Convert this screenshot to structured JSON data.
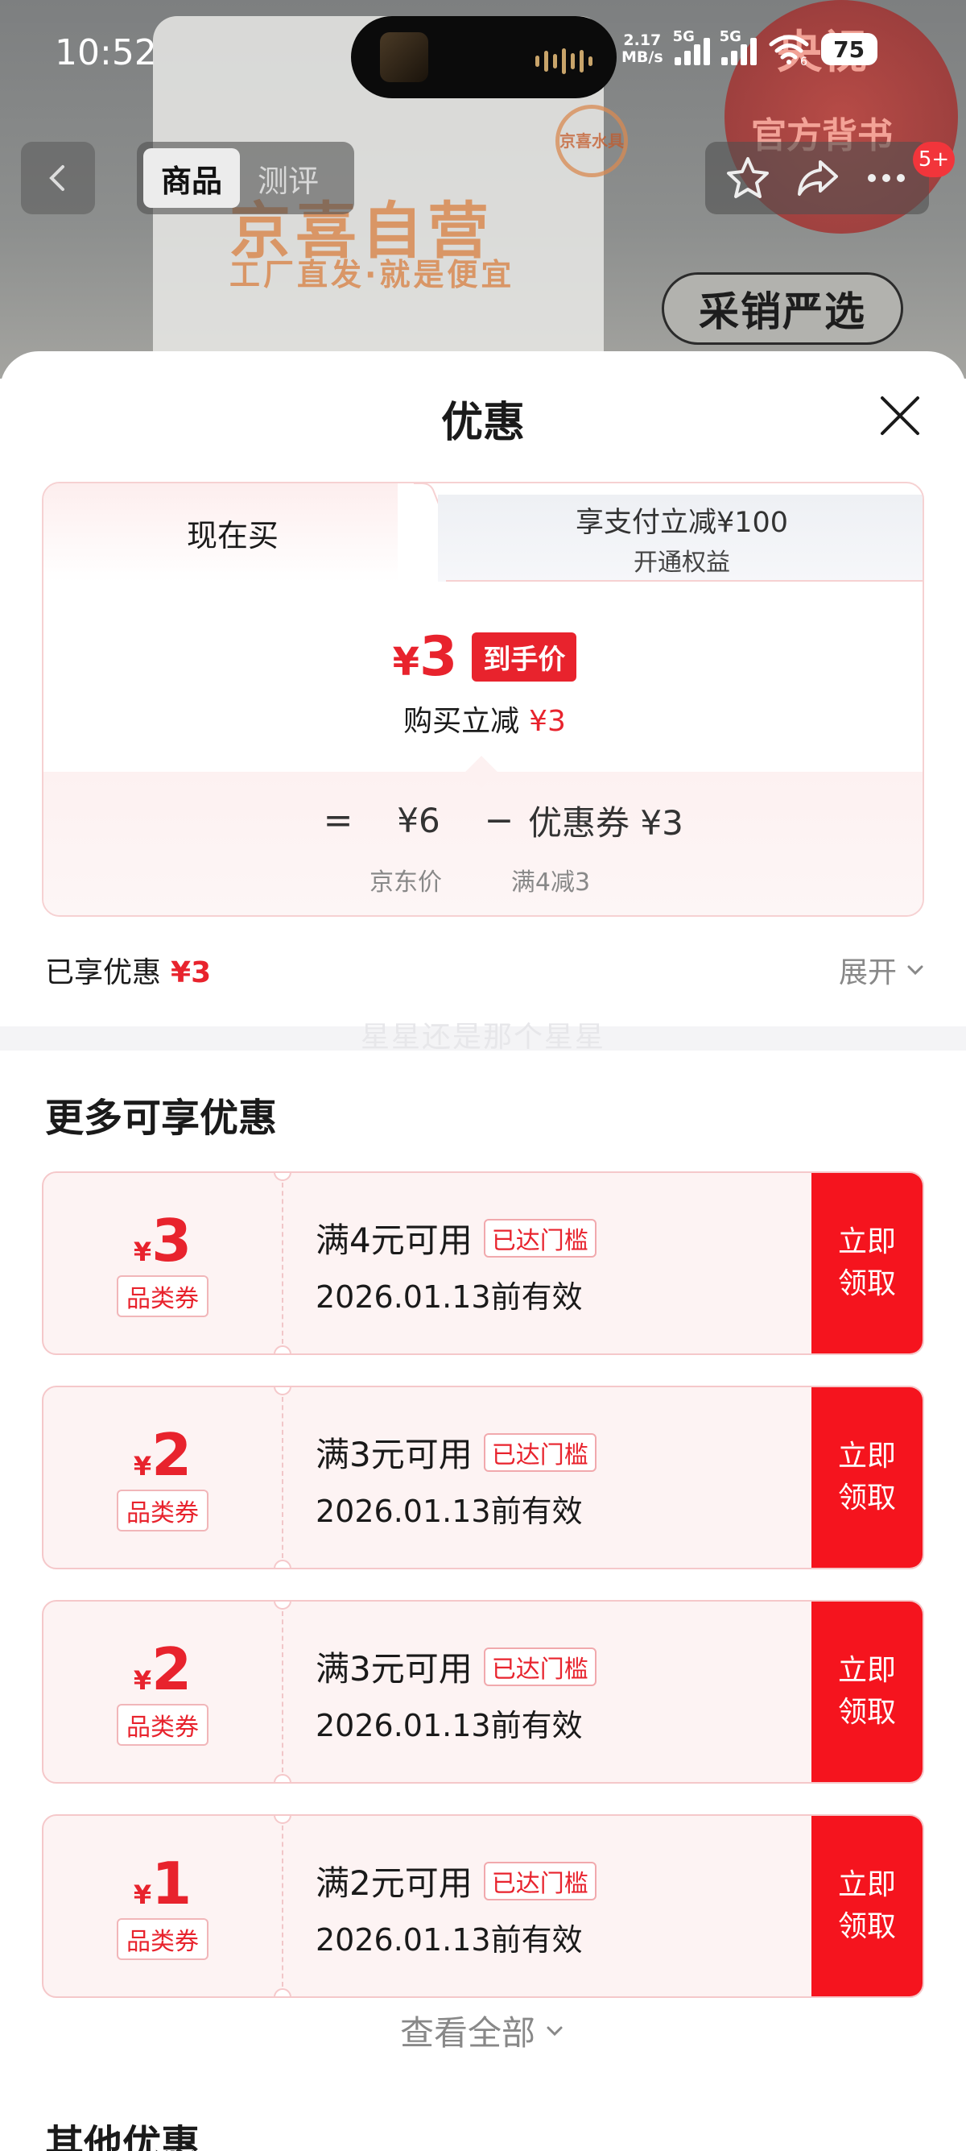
{
  "status_bar": {
    "time": "10:52",
    "speed_line1": "2.17",
    "speed_line2": "MB/s",
    "network1": "5G",
    "network2": "5G",
    "wifi_sub": "6",
    "battery": "75"
  },
  "background": {
    "bag_brand": "京喜自营",
    "bag_slogan": "工厂直发·就是便宜",
    "bag_logo": "京喜水具",
    "seal_line1": "央视",
    "seal_line2": "官方背书",
    "tag": "采销严选"
  },
  "nav": {
    "tabs": [
      {
        "label": "商品",
        "active": true
      },
      {
        "label": "测评",
        "active": false
      }
    ],
    "actions": [
      "star-icon",
      "share-icon",
      "more-icon"
    ],
    "badge": "5+"
  },
  "sheet": {
    "title": "优惠",
    "close_icon": "close-icon",
    "tabs": {
      "now": "现在买",
      "pay_title": "享支付立减¥100",
      "pay_sub": "开通权益"
    },
    "final_price": {
      "currency": "¥",
      "value": "3",
      "tag": "到手价"
    },
    "reduce": {
      "label": "购买立减",
      "value": "¥3"
    },
    "formula": {
      "equals": "=",
      "jd_price": "¥6",
      "minus": "−",
      "coupon": "优惠券 ¥3",
      "jd_price_label": "京东价",
      "coupon_label": "满4减3"
    },
    "enjoyed": {
      "label": "已享优惠",
      "value": "¥3",
      "expand": "展开"
    },
    "watermark": "星星还是那个星星",
    "more_title": "更多可享优惠",
    "coupons": [
      {
        "currency": "¥",
        "amount": "3",
        "type": "品类券",
        "condition": "满4元可用",
        "status": "已达门槛",
        "expiry": "2026.01.13前有效",
        "btn1": "立即",
        "btn2": "领取"
      },
      {
        "currency": "¥",
        "amount": "2",
        "type": "品类券",
        "condition": "满3元可用",
        "status": "已达门槛",
        "expiry": "2026.01.13前有效",
        "btn1": "立即",
        "btn2": "领取"
      },
      {
        "currency": "¥",
        "amount": "2",
        "type": "品类券",
        "condition": "满3元可用",
        "status": "已达门槛",
        "expiry": "2026.01.13前有效",
        "btn1": "立即",
        "btn2": "领取"
      },
      {
        "currency": "¥",
        "amount": "1",
        "type": "品类券",
        "condition": "满2元可用",
        "status": "已达门槛",
        "expiry": "2026.01.13前有效",
        "btn1": "立即",
        "btn2": "领取"
      }
    ],
    "view_all": "查看全部",
    "other_title": "其他优惠"
  },
  "colors": {
    "accent_red": "#e8232d",
    "button_red": "#f5141e"
  }
}
